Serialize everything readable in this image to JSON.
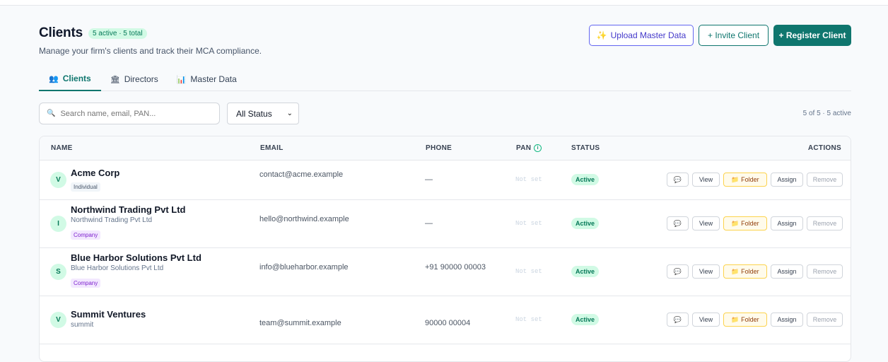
{
  "header": {
    "title": "Clients",
    "badge": "5 active · 5 total",
    "subtitle": "Manage your firm's clients and track their MCA compliance."
  },
  "top_actions": {
    "upload": "Upload Master Data",
    "upload_icon": "sparkle-icon",
    "invite": "+ Invite Client",
    "register": "+ Register Client"
  },
  "tabs": [
    {
      "label": "Clients",
      "icon": "people-icon",
      "active": true
    },
    {
      "label": "Directors",
      "icon": "bank-icon",
      "active": false
    },
    {
      "label": "Master Data",
      "icon": "chart-icon",
      "active": false
    }
  ],
  "filters": {
    "search_placeholder": "Search name, email, PAN...",
    "status_value": "All Status",
    "count": "5 of 5 · 5 active"
  },
  "table": {
    "headers": {
      "name": "NAME",
      "email": "EMAIL",
      "phone": "PHONE",
      "pan": "PAN",
      "status": "STATUS",
      "actions": "ACTIONS"
    },
    "row_actions": {
      "view": "View",
      "folder": "Folder",
      "assign": "Assign",
      "remove": "Remove"
    },
    "rows": [
      {
        "avatar": "V",
        "name": "Acme Corp",
        "sub": "",
        "type": "Individual",
        "email": "contact@acme.example",
        "phone": "—",
        "pan": "Not set",
        "status": "Active"
      },
      {
        "avatar": "I",
        "name": "Northwind Trading Pvt Ltd",
        "sub": "Northwind Trading Pvt Ltd",
        "type": "Company",
        "email": "hello@northwind.example",
        "phone": "—",
        "pan": "Not set",
        "status": "Active"
      },
      {
        "avatar": "S",
        "name": "Blue Harbor Solutions Pvt Ltd",
        "sub": "Blue Harbor Solutions Pvt Ltd",
        "type": "Company",
        "email": "info@blueharbor.example",
        "phone": "+91 90000 00003",
        "pan": "Not set",
        "status": "Active"
      },
      {
        "avatar": "V",
        "name": "Summit Ventures",
        "sub": "summit",
        "type": "",
        "email": "team@summit.example",
        "phone": "90000 00004",
        "pan": "Not set",
        "status": "Active"
      }
    ]
  }
}
